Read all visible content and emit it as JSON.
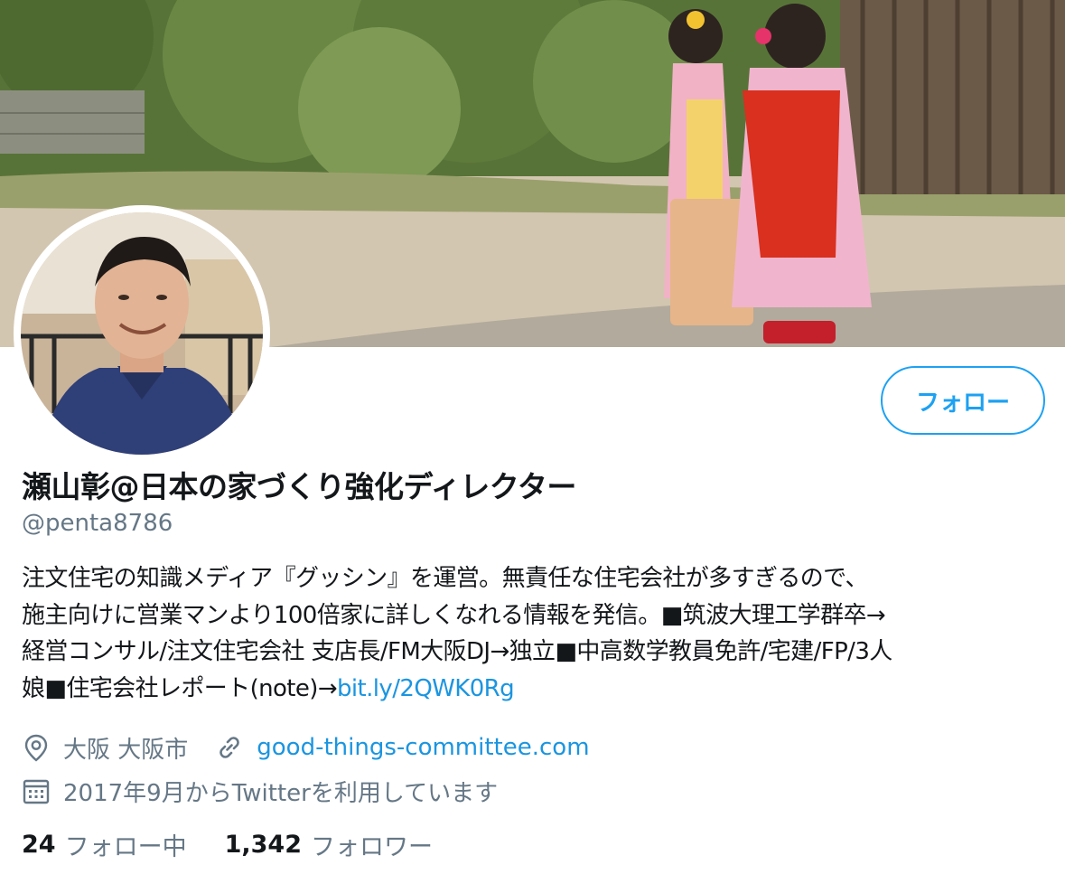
{
  "profile": {
    "display_name": "瀬山彰@日本の家づくり強化ディレクター",
    "handle": "@penta8786",
    "bio_lines": [
      "注文住宅の知識メディア『グッシン』を運営。無責任な住宅会社が多すぎるので、",
      "施主向けに営業マンより100倍家に詳しくなれる情報を発信。■筑波大理工学群卒→",
      "経営コンサル/注文住宅会社 支店長/FM大阪DJ→独立■中高数学教員免許/宅建/FP/3人"
    ],
    "bio_last_line_prefix": "娘■住宅会社レポート(note)→",
    "bio_link": "bit.ly/2QWK0Rg",
    "location": "大阪 大阪市",
    "website": "good-things-committee.com",
    "joined": "2017年9月からTwitterを利用しています",
    "icons": {
      "location": "location-pin-icon",
      "website": "link-icon",
      "joined": "calendar-icon"
    }
  },
  "actions": {
    "follow_label": "フォロー"
  },
  "stats": {
    "following_count": "24",
    "following_label": "フォロー中",
    "followers_count": "1,342",
    "followers_label": "フォロワー"
  },
  "colors": {
    "accent": "#1da1f2",
    "link": "#1b95e0",
    "text_primary": "#14171a",
    "text_secondary": "#657786"
  }
}
